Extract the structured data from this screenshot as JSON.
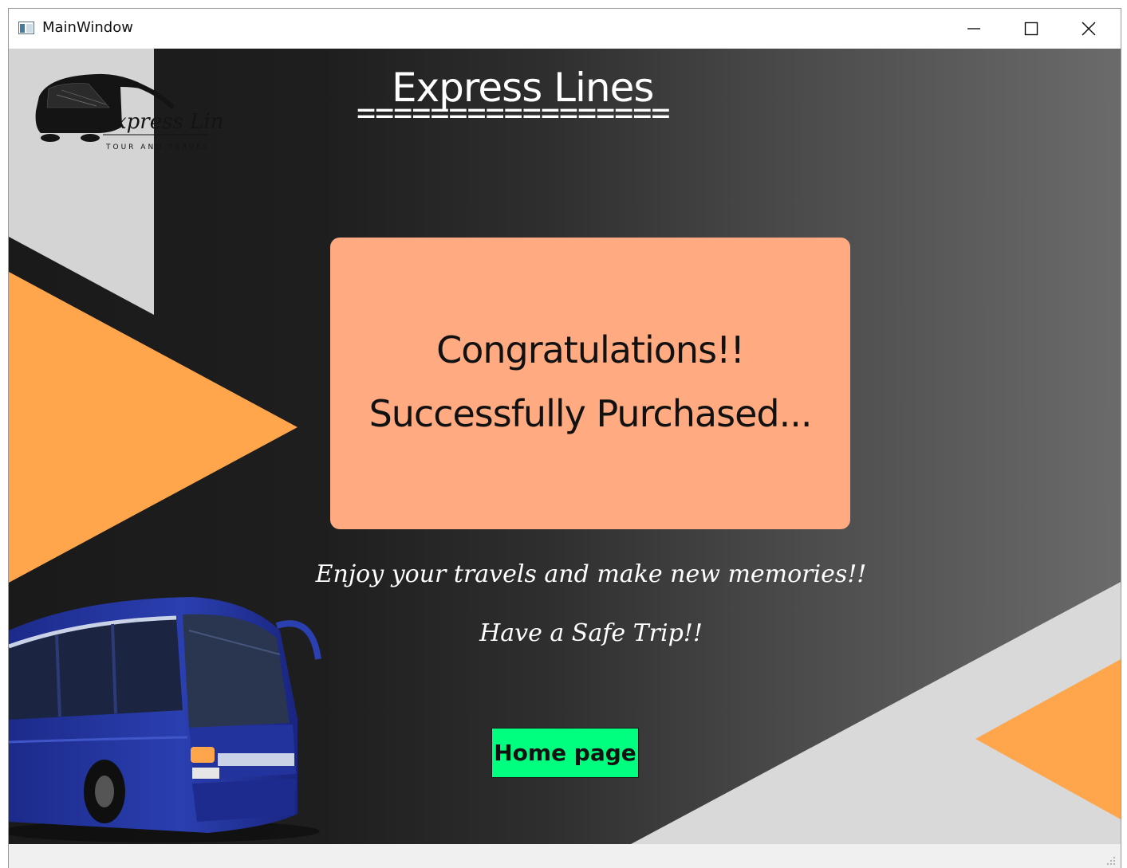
{
  "window": {
    "title": "MainWindow"
  },
  "header": {
    "title": "Express Lines",
    "rule": "================="
  },
  "logo": {
    "brand": "Express Lines",
    "tagline": "TOUR AND TRAVEL"
  },
  "card": {
    "line1": "Congratulations!!",
    "line2": "Successfully Purchased..."
  },
  "messages": {
    "enjoy": "Enjoy your travels and make new memories!!",
    "safe_trip": "Have a Safe Trip!!"
  },
  "buttons": {
    "home": "Home page"
  },
  "colors": {
    "card": "#ffaa80",
    "home_button": "#00ff7f",
    "accent_orange": "#ffa64d",
    "panel_light": "#d9d9d9"
  },
  "icons": {
    "app": "window-icon",
    "minimize": "minimize-icon",
    "maximize": "maximize-icon",
    "close": "close-icon",
    "bus": "bus-image",
    "grip": "size-grip-icon"
  }
}
